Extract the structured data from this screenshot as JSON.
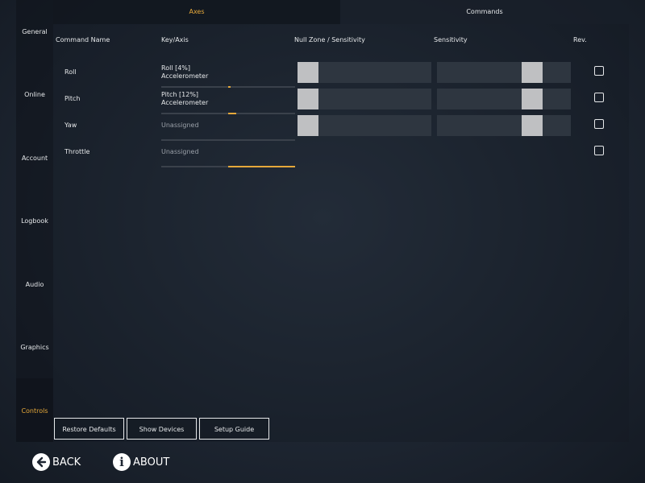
{
  "sidebar": {
    "items": [
      {
        "label": "General"
      },
      {
        "label": "Online"
      },
      {
        "label": "Account"
      },
      {
        "label": "Logbook"
      },
      {
        "label": "Audio"
      },
      {
        "label": "Graphics"
      },
      {
        "label": "Controls"
      }
    ]
  },
  "tabs": {
    "axes": "Axes",
    "commands": "Commands"
  },
  "columns": {
    "command_name": "Command Name",
    "key_axis": "Key/Axis",
    "null_zone": "Null Zone / Sensitivity",
    "sensitivity": "Sensitivity",
    "rev": "Rev."
  },
  "rows": [
    {
      "name": "Roll",
      "key_line1": "Roll [4%]",
      "key_line2": "Accelerometer",
      "axis_fill_start": 0.5,
      "axis_fill_end": 0.52,
      "null_zone": 0.0,
      "sensitivity": 0.75,
      "reversed": false
    },
    {
      "name": "Pitch",
      "key_line1": "Pitch [12%]",
      "key_line2": "Accelerometer",
      "axis_fill_start": 0.5,
      "axis_fill_end": 0.56,
      "null_zone": 0.0,
      "sensitivity": 0.75,
      "reversed": false
    },
    {
      "name": "Yaw",
      "key_line1": "Unassigned",
      "key_line2": "",
      "axis_fill_start": 0.0,
      "axis_fill_end": 0.0,
      "null_zone": 0.0,
      "sensitivity": 0.75,
      "reversed": false
    },
    {
      "name": "Throttle",
      "key_line1": "Unassigned",
      "key_line2": "",
      "axis_fill_start": 0.5,
      "axis_fill_end": 1.0,
      "reversed": false
    }
  ],
  "buttons": {
    "restore_defaults": "Restore Defaults",
    "show_devices": "Show Devices",
    "setup_guide": "Setup Guide"
  },
  "footer": {
    "back": "BACK",
    "about": "ABOUT"
  },
  "colors": {
    "accent": "#e5a83a",
    "background": "#1e2632",
    "slider_track": "#2e3640",
    "slider_thumb": "#bfc0c2"
  }
}
